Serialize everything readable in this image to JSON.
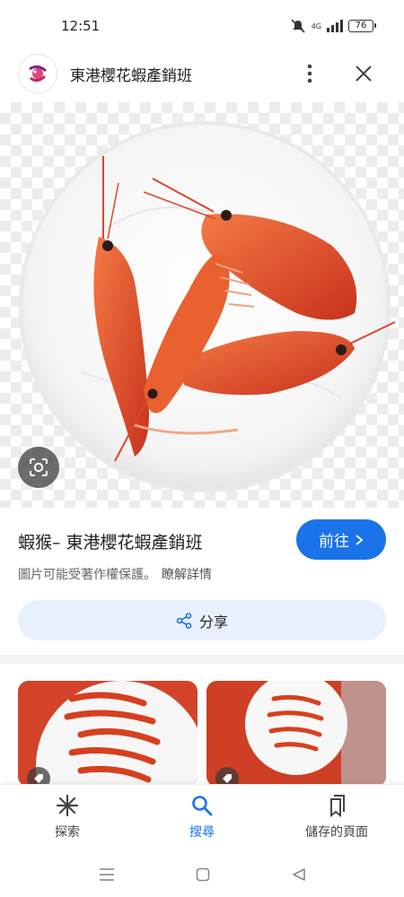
{
  "status": {
    "time": "12:51",
    "battery": "76",
    "network": "4G"
  },
  "header": {
    "site_title": "東港櫻花蝦產銷班"
  },
  "hero": {
    "image": "shrimp-photo"
  },
  "result": {
    "title": "蝦猴– 東港櫻花蝦產銷班",
    "visit_label": "前往",
    "copyright_text": "圖片可能受著作權保護。",
    "learn_more": "瞭解詳情",
    "share_label": "分享"
  },
  "bottom_nav": {
    "items": [
      {
        "label": "探索",
        "icon": "asterisk-icon"
      },
      {
        "label": "搜尋",
        "icon": "search-icon",
        "active": true
      },
      {
        "label": "儲存的頁面",
        "icon": "bookmarks-icon"
      }
    ]
  },
  "colors": {
    "accent": "#1a73e8",
    "share_bg": "#e8f0fe"
  }
}
